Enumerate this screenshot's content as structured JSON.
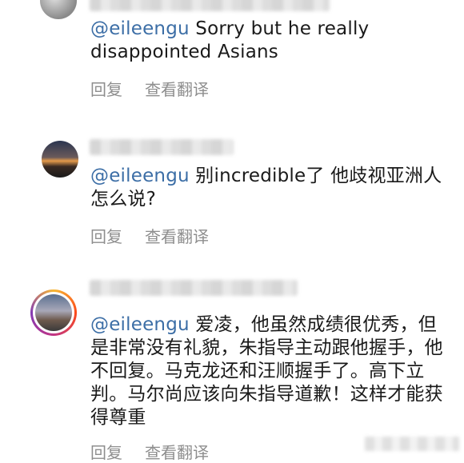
{
  "comments": [
    {
      "mention": "@eileengu",
      "text": " Sorry but he really disappointed Asians",
      "reply_label": "回复",
      "translate_label": "查看翻译"
    },
    {
      "mention": "@eileengu",
      "text": " 别incredible了 他歧视亚洲人怎么说?",
      "reply_label": "回复",
      "translate_label": "查看翻译"
    },
    {
      "mention": "@eileengu",
      "text": " 爱凌，他虽然成绩很优秀，但是非常没有礼貌，朱指导主动跟他握手，他不回复。马克龙还和汪顺握手了。高下立判。马尔尚应该向朱指导道歉！这样才能获得尊重",
      "reply_label": "回复",
      "translate_label": "查看翻译"
    }
  ],
  "colors": {
    "mention": "#3c6ea6",
    "action_text": "#8e8e8e",
    "story_ring_start": "#f7b733",
    "story_ring_end": "#c13584"
  }
}
